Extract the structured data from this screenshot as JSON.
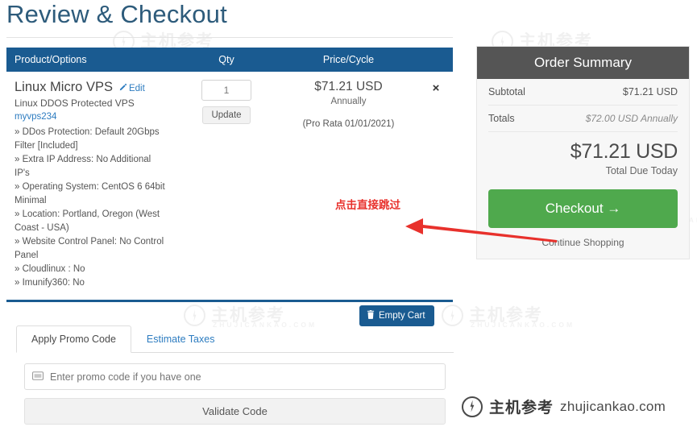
{
  "page": {
    "title": "Review & Checkout"
  },
  "cart": {
    "columns": {
      "product": "Product/Options",
      "qty": "Qty",
      "price": "Price/Cycle",
      "remove": ""
    },
    "item": {
      "name": "Linux Micro VPS",
      "edit_label": "Edit",
      "subtitle": "Linux DDOS Protected VPS",
      "identifier": "myvps234",
      "config": [
        "» DDos Protection: Default 20Gbps Filter [Included]",
        "» Extra IP Address: No Additional IP's",
        "» Operating System: CentOS 6 64bit Minimal",
        "» Location: Portland, Oregon (West Coast - USA)",
        "» Website Control Panel: No Control Panel",
        "» Cloudlinux : No",
        "» Imunify360: No"
      ],
      "qty_value": "1",
      "update_label": "Update",
      "price": "$71.21 USD",
      "cycle": "Annually",
      "pro_rata": "(Pro Rata 01/01/2021)",
      "remove_glyph": "×"
    },
    "empty_cart_label": "Empty Cart"
  },
  "promo": {
    "tabs": [
      {
        "label": "Apply Promo Code",
        "active": true
      },
      {
        "label": "Estimate Taxes",
        "active": false
      }
    ],
    "input_value": "",
    "input_placeholder": "Enter promo code if you have one",
    "validate_label": "Validate Code"
  },
  "summary": {
    "heading": "Order Summary",
    "rows": [
      {
        "label": "Subtotal",
        "value": "$71.21 USD"
      },
      {
        "label": "Totals",
        "value": "$72.00 USD Annually"
      }
    ],
    "due_amount": "$71.21 USD",
    "due_label": "Total Due Today",
    "checkout_label": "Checkout",
    "checkout_arrow": "→",
    "continue_label": "Continue Shopping"
  },
  "annotation": {
    "text": "点击直接跳过",
    "color": "#e8312c"
  },
  "watermark": {
    "cn": "主机参考",
    "domain": "ZHUJICANKAO.COM"
  },
  "footer_logo": {
    "cn": "主机参考",
    "domain": "zhujicankao.com"
  },
  "colors": {
    "title": "#2d5b7b",
    "table_header": "#1a5b91",
    "summary_header": "#555555",
    "checkout_green": "#4fa94d",
    "link_blue": "#2d7cc0",
    "annotation_red": "#e8312c"
  }
}
